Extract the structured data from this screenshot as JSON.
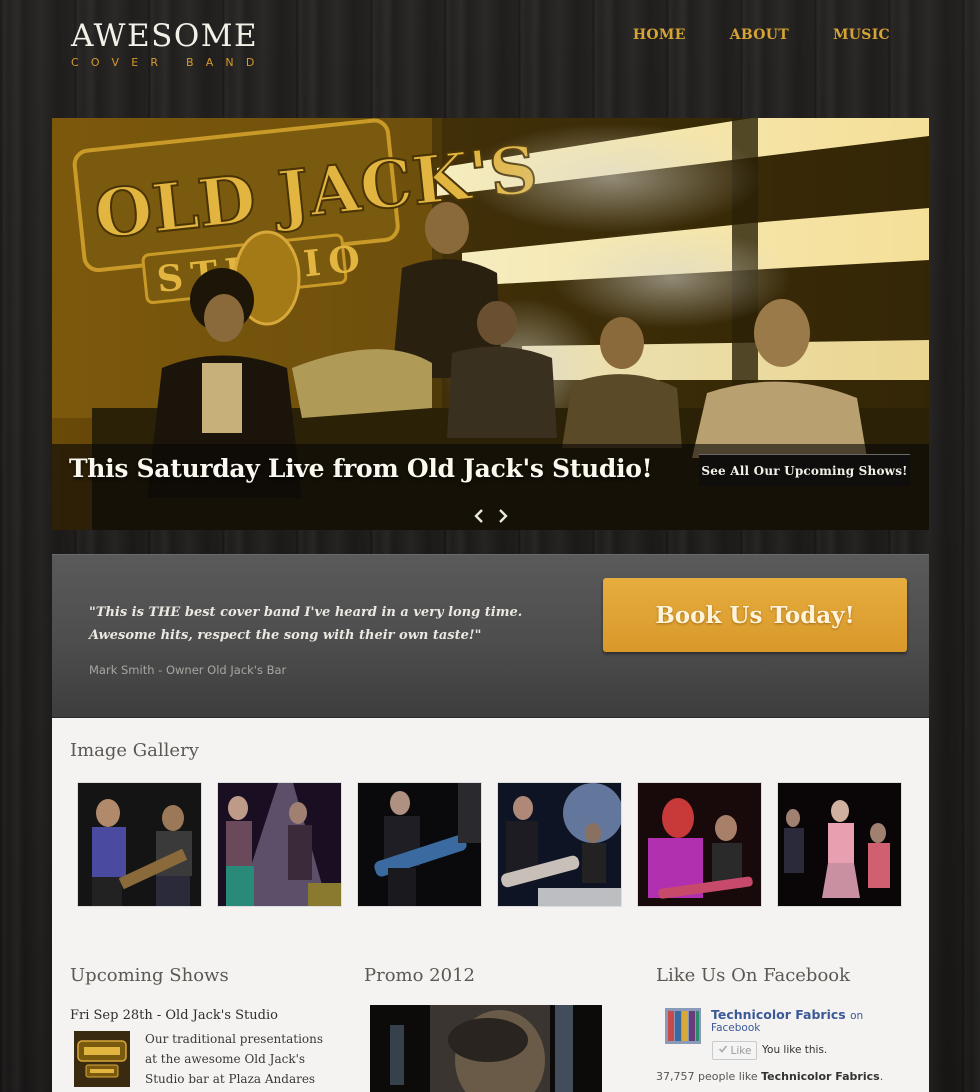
{
  "header": {
    "logo_main": "AWESOME",
    "logo_sub": "COVER BAND",
    "nav": [
      {
        "label": "HOME"
      },
      {
        "label": "ABOUT"
      },
      {
        "label": "MUSIC"
      }
    ]
  },
  "hero": {
    "title": "This Saturday Live from Old Jack's Studio!",
    "button_label": "See All Our Upcoming Shows!",
    "sign_text": "OLD JACK'S",
    "sign_sub": "STUDIO"
  },
  "testimonial": {
    "quote": "\"This is THE best cover band I've heard in a very long time. Awesome hits, respect the song with their own taste!\"",
    "author": "Mark Smith - Owner Old Jack's Bar",
    "cta_label": "Book Us Today!"
  },
  "gallery": {
    "title": "Image Gallery"
  },
  "shows": {
    "title": "Upcoming Shows",
    "date": "Fri Sep 28th - Old Jack's Studio",
    "description": "Our traditional presentations at the awesome Old Jack's Studio bar at Plaza Andares"
  },
  "promo": {
    "title": "Promo 2012"
  },
  "facebook": {
    "title": "Like Us On Facebook",
    "page_name": "Technicolor Fabrics",
    "on_text": "on",
    "facebook_text": "Facebook",
    "like_label": "Like",
    "you_like": "You like this.",
    "count_prefix": "37,757 people like",
    "count_page": "Technicolor Fabrics",
    "count_suffix": "."
  },
  "colors": {
    "accent": "#d6a434",
    "cta": "#e6ad3e",
    "fb_blue": "#3b5998"
  }
}
